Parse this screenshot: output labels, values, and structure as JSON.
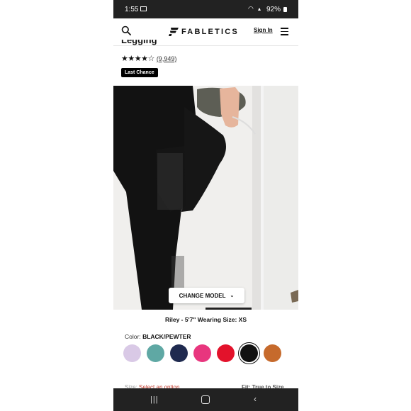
{
  "status_bar": {
    "time": "1:55",
    "battery": "92%"
  },
  "header": {
    "brand": "FABLETICS",
    "sign_in": "Sign In"
  },
  "product": {
    "title_fragment": "Legging",
    "rating_stars": "★★★★☆",
    "review_count": "(9,949)",
    "rating_value": 4,
    "badge": "Last Chance"
  },
  "gallery": {
    "change_model_label": "CHANGE MODEL",
    "progress_fraction": 0.25
  },
  "model_info": "Riley - 5'7\" Wearing Size: XS",
  "color": {
    "label": "Color:",
    "selected": "BLACK/PEWTER",
    "swatches": [
      "#d9c9e6",
      "#5fa8a4",
      "#1f2a4f",
      "#e8367e",
      "#e3122b",
      "#111111",
      "#c66a2c"
    ],
    "selected_index": 5
  },
  "size_row": {
    "size_label": "Size:",
    "size_value": "Select an option",
    "fit": "Fit: True to Size"
  }
}
